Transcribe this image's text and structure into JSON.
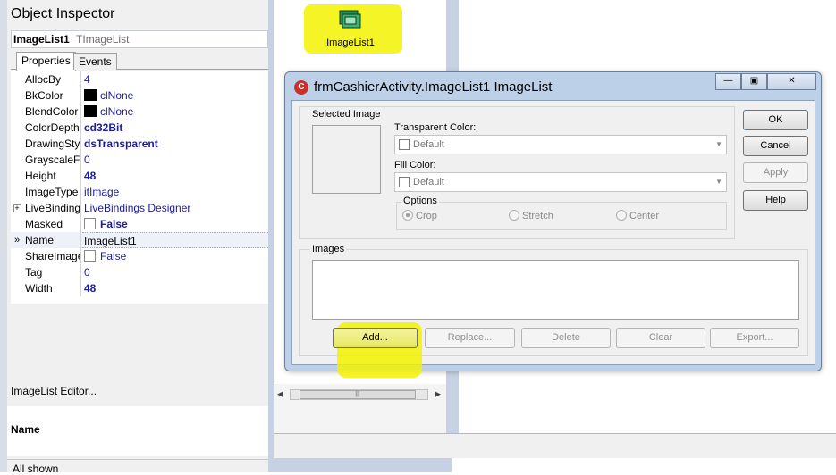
{
  "inspector": {
    "title": "Object Inspector",
    "component_name": "ImageList1",
    "component_type": "TImageList",
    "tabs": [
      {
        "label": "Properties",
        "active": true
      },
      {
        "label": "Events",
        "active": false
      }
    ],
    "properties": [
      {
        "name": "AllocBy",
        "value": "4"
      },
      {
        "name": "BkColor",
        "value": "clNone",
        "swatch": "#000000"
      },
      {
        "name": "BlendColor",
        "value": "clNone",
        "swatch": "#000000"
      },
      {
        "name": "ColorDepth",
        "value": "cd32Bit"
      },
      {
        "name": "DrawingStyle",
        "value": "dsTransparent"
      },
      {
        "name": "GrayscaleFactor",
        "value": "0"
      },
      {
        "name": "Height",
        "value": "48"
      },
      {
        "name": "ImageType",
        "value": "itImage"
      },
      {
        "name": "LiveBindings",
        "value": "LiveBindings Designer",
        "expandable": true
      },
      {
        "name": "Masked",
        "value": "False",
        "checkbox": true
      },
      {
        "name": "Name",
        "value": "ImageList1",
        "selected": true
      },
      {
        "name": "ShareImages",
        "value": "False",
        "checkbox": true
      },
      {
        "name": "Tag",
        "value": "0"
      },
      {
        "name": "Width",
        "value": "48"
      }
    ],
    "editor_link": "ImageList Editor...",
    "description_title": "Name",
    "status": "All shown"
  },
  "designer": {
    "component_label": "ImageList1",
    "component_icon": "imagelist-icon"
  },
  "dialog": {
    "title": "frmCashierActivity.ImageList1 ImageList",
    "selected_image_label": "Selected Image",
    "transparent_color": {
      "label": "Transparent Color:",
      "value": "Default"
    },
    "fill_color": {
      "label": "Fill Color:",
      "value": "Default"
    },
    "options": {
      "label": "Options",
      "items": [
        {
          "label": "Crop",
          "checked": true
        },
        {
          "label": "Stretch",
          "checked": false
        },
        {
          "label": "Center",
          "checked": false
        }
      ]
    },
    "images_label": "Images",
    "buttons": {
      "ok": "OK",
      "cancel": "Cancel",
      "apply": "Apply",
      "help": "Help",
      "add": "Add...",
      "replace": "Replace...",
      "delete": "Delete",
      "clear": "Clear",
      "export": "Export..."
    },
    "highlight_color": "#f2f200"
  }
}
